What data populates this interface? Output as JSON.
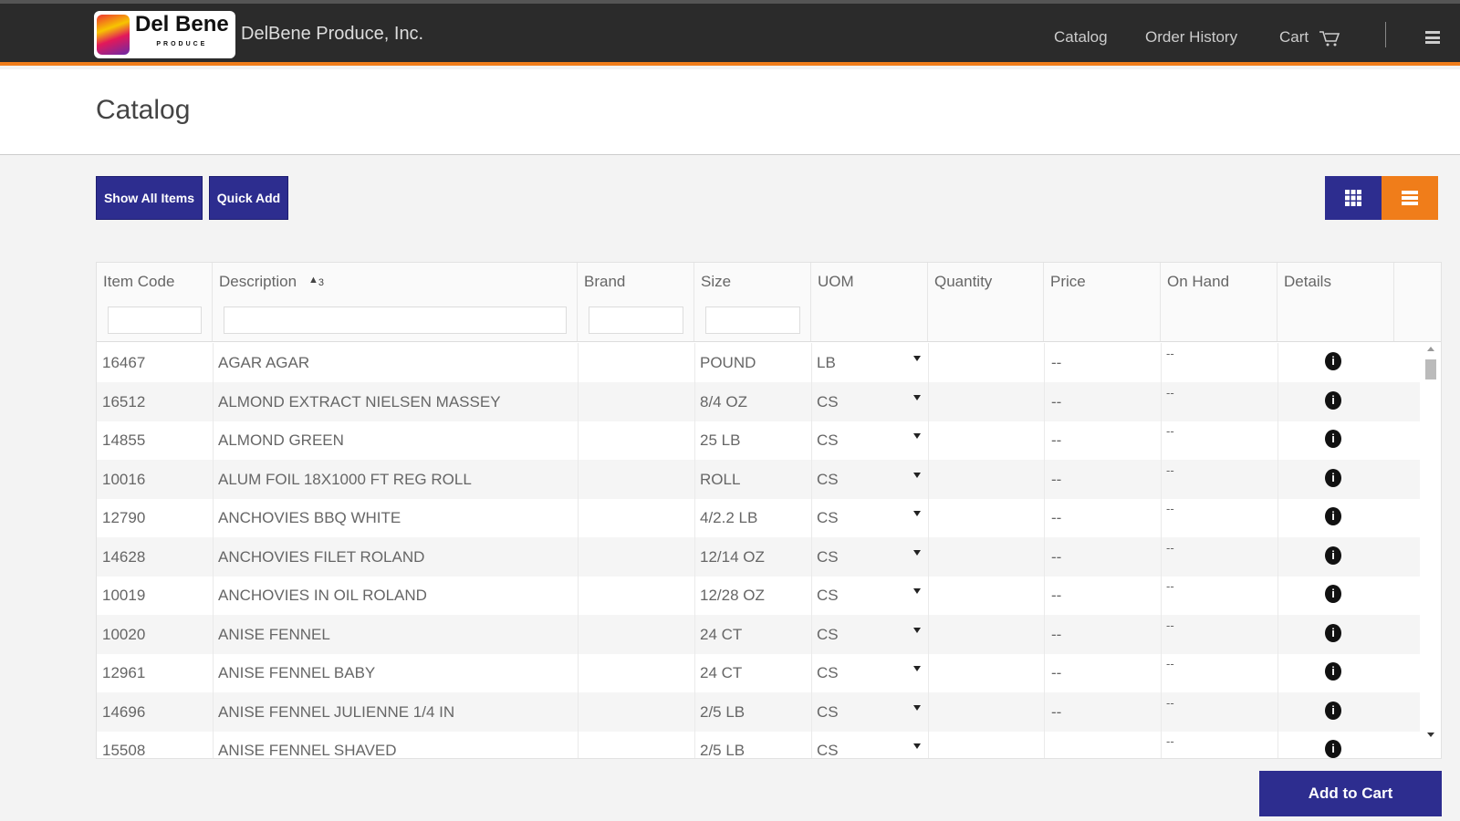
{
  "header": {
    "logo_text": "Del Bene",
    "logo_sub": "PRODUCE",
    "company": "DelBene Produce, Inc.",
    "nav": [
      "Catalog",
      "Order History",
      "Cart"
    ]
  },
  "page": {
    "title": "Catalog"
  },
  "toolbar": {
    "show_all": "Show All Items",
    "quick_add": "Quick Add",
    "grid_view_color": "#2d2d8f",
    "list_view_color": "#f07d1a"
  },
  "table": {
    "columns": [
      "Item Code",
      "Description",
      "Brand",
      "Size",
      "UOM",
      "Quantity",
      "Price",
      "On Hand",
      "Details"
    ],
    "sort": {
      "column": "Description",
      "direction": "asc",
      "order": "3"
    },
    "rows": [
      {
        "code": "16467",
        "desc": "AGAR AGAR",
        "brand": "",
        "size": "POUND",
        "uom": "LB",
        "price": "--",
        "onhand": "--"
      },
      {
        "code": "16512",
        "desc": "ALMOND EXTRACT NIELSEN MASSEY",
        "brand": "",
        "size": "8/4 OZ",
        "uom": "CS",
        "price": "--",
        "onhand": "--"
      },
      {
        "code": "14855",
        "desc": "ALMOND GREEN",
        "brand": "",
        "size": "25 LB",
        "uom": "CS",
        "price": "--",
        "onhand": "--"
      },
      {
        "code": "10016",
        "desc": "ALUM FOIL 18X1000 FT REG ROLL",
        "brand": "",
        "size": "ROLL",
        "uom": "CS",
        "price": "--",
        "onhand": "--"
      },
      {
        "code": "12790",
        "desc": "ANCHOVIES BBQ WHITE",
        "brand": "",
        "size": "4/2.2 LB",
        "uom": "CS",
        "price": "--",
        "onhand": "--"
      },
      {
        "code": "14628",
        "desc": "ANCHOVIES FILET ROLAND",
        "brand": "",
        "size": "12/14 OZ",
        "uom": "CS",
        "price": "--",
        "onhand": "--"
      },
      {
        "code": "10019",
        "desc": "ANCHOVIES IN OIL ROLAND",
        "brand": "",
        "size": "12/28 OZ",
        "uom": "CS",
        "price": "--",
        "onhand": "--"
      },
      {
        "code": "10020",
        "desc": "ANISE FENNEL",
        "brand": "",
        "size": "24 CT",
        "uom": "CS",
        "price": "--",
        "onhand": "--"
      },
      {
        "code": "12961",
        "desc": "ANISE FENNEL BABY",
        "brand": "",
        "size": "24 CT",
        "uom": "CS",
        "price": "--",
        "onhand": "--"
      },
      {
        "code": "14696",
        "desc": "ANISE FENNEL JULIENNE 1/4 IN",
        "brand": "",
        "size": "2/5 LB",
        "uom": "CS",
        "price": "--",
        "onhand": "--"
      },
      {
        "code": "15508",
        "desc": "ANISE FENNEL SHAVED",
        "brand": "",
        "size": "2/5 LB",
        "uom": "CS",
        "price": "",
        "onhand": "--"
      }
    ]
  },
  "footer": {
    "add_to_cart": "Add to Cart"
  }
}
